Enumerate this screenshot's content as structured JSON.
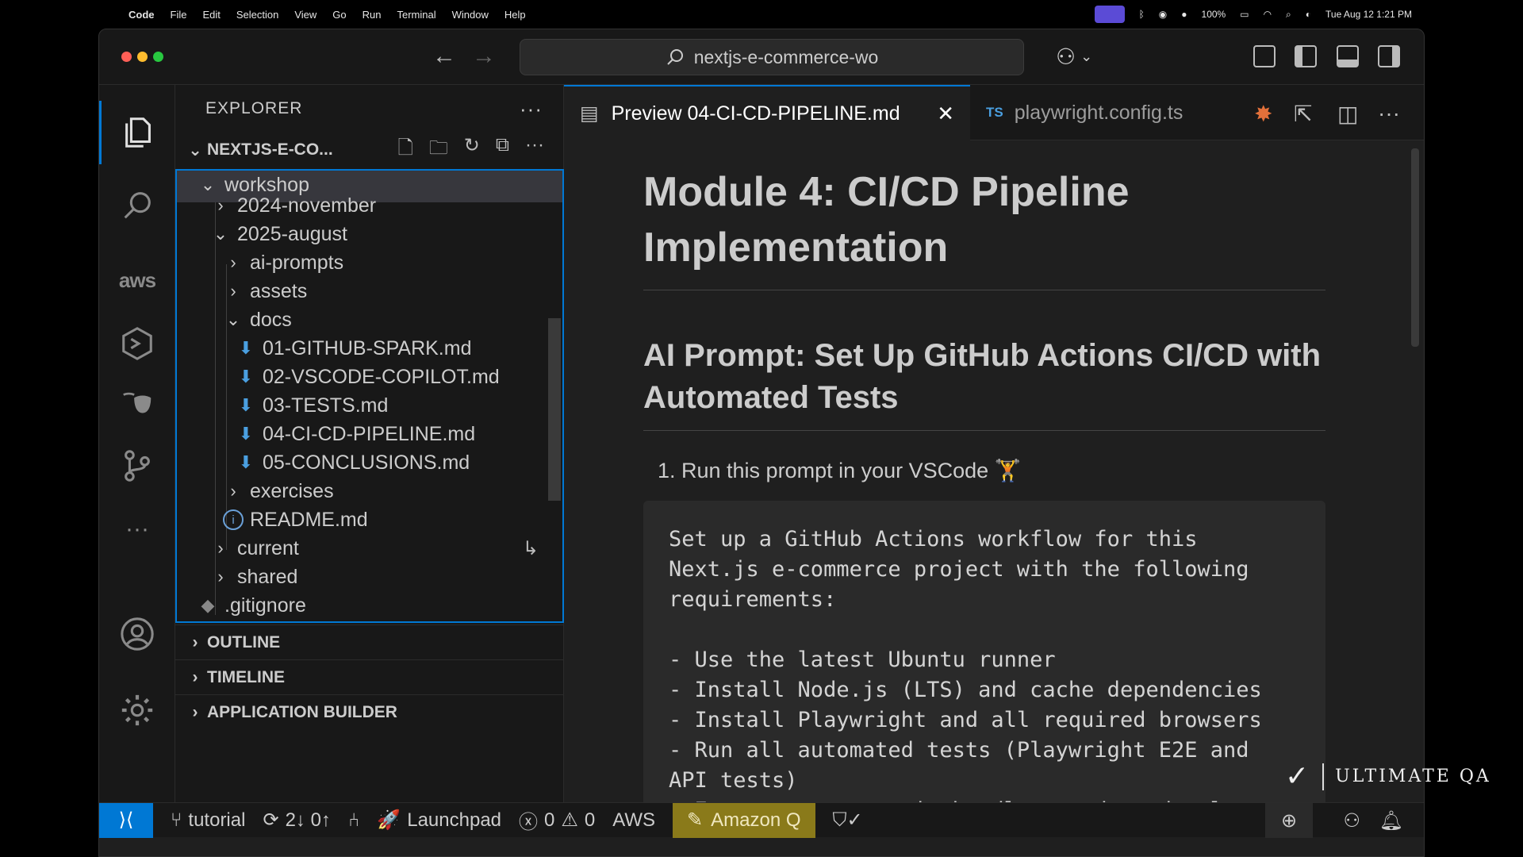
{
  "menubar": {
    "app": "Code",
    "items": [
      "File",
      "Edit",
      "Selection",
      "View",
      "Go",
      "Run",
      "Terminal",
      "Window",
      "Help"
    ],
    "battery": "100%",
    "clock": "Tue Aug 12  1:21 PM"
  },
  "titlebar": {
    "search": "nextjs-e-commerce-wo"
  },
  "sidebar": {
    "title": "EXPLORER",
    "root": "NEXTJS-E-CO...",
    "tree": [
      {
        "label": "workshop"
      },
      {
        "label": "2024-november"
      },
      {
        "label": "2025-august"
      },
      {
        "label": "ai-prompts"
      },
      {
        "label": "assets"
      },
      {
        "label": "docs"
      },
      {
        "label": "01-GITHUB-SPARK.md"
      },
      {
        "label": "02-VSCODE-COPILOT.md"
      },
      {
        "label": "03-TESTS.md"
      },
      {
        "label": "04-CI-CD-PIPELINE.md"
      },
      {
        "label": "05-CONCLUSIONS.md"
      },
      {
        "label": "exercises"
      },
      {
        "label": "README.md"
      },
      {
        "label": "current"
      },
      {
        "label": "shared"
      },
      {
        "label": ".gitignore"
      }
    ],
    "sections": [
      "OUTLINE",
      "TIMELINE",
      "APPLICATION BUILDER"
    ]
  },
  "activity": {
    "aws_label": "aws"
  },
  "tabs": {
    "active": "Preview 04-CI-CD-PIPELINE.md",
    "other_badge": "TS",
    "other": "playwright.config.ts"
  },
  "preview": {
    "h1": "Module 4: CI/CD Pipeline Implementation",
    "h2": "AI Prompt: Set Up GitHub Actions CI/CD with Automated Tests",
    "step": "Run this prompt in your VSCode 🏋",
    "code": "Set up a GitHub Actions workflow for this\nNext.js e-commerce project with the following\nrequirements:\n\n- Use the latest Ubuntu runner\n- Install Node.js (LTS) and cache dependencies\n- Install Playwright and all required browsers\n- Run all automated tests (Playwright E2E and\nAPI tests)\n- Ensure tests run in headless mode and only"
  },
  "statusbar": {
    "branch": "tutorial",
    "sync": "2↓ 0↑",
    "launchpad": "Launchpad",
    "errors": "0",
    "warnings": "0",
    "aws": "AWS",
    "amazonq": "Amazon Q"
  },
  "watermark": {
    "text": "ULTIMATE QA"
  },
  "colors": {
    "accent": "#0078d4",
    "amazonq_bg": "#8a7a1a",
    "md_icon": "#4a9fe0"
  }
}
